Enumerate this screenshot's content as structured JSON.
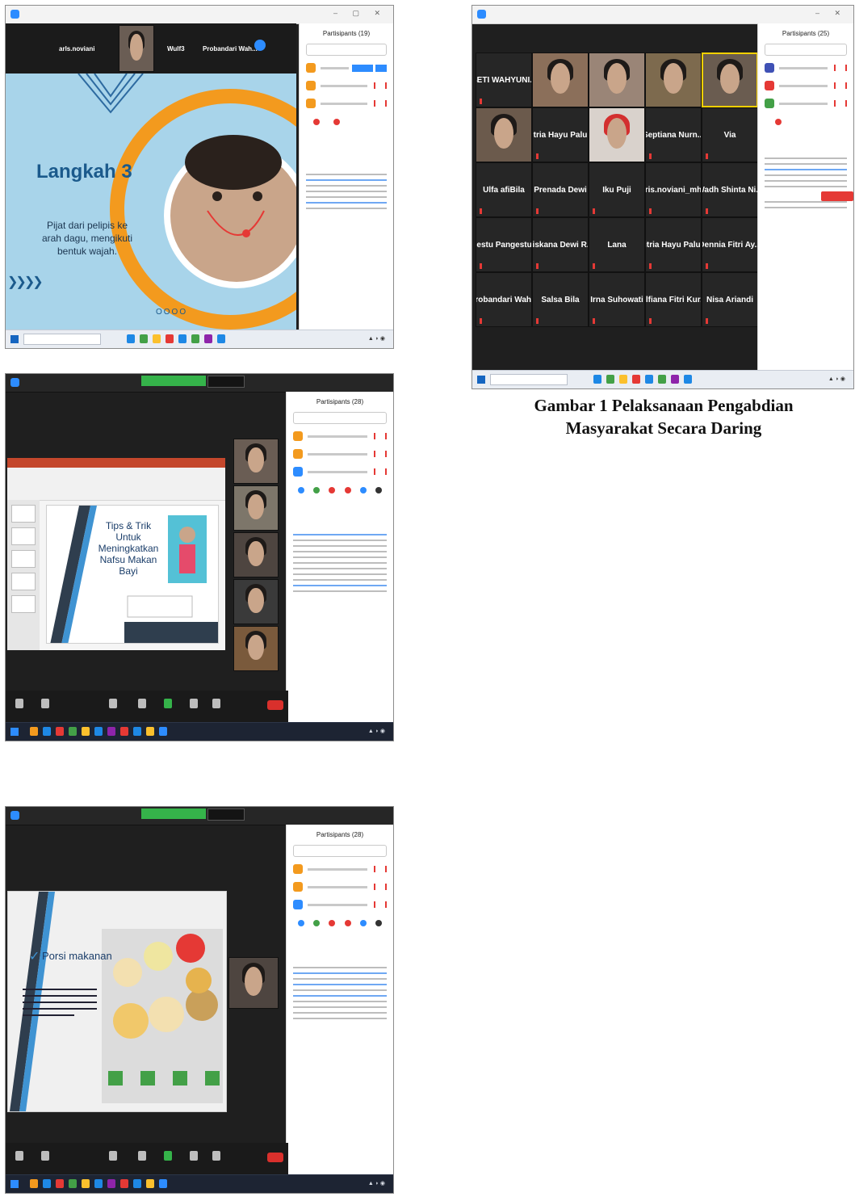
{
  "caption": {
    "line1": "Gambar 1 Pelaksanaan Pengabdian",
    "line2": "Masyarakat Secara Daring"
  },
  "shot1": {
    "top_names": [
      "arls.noviani",
      "Wulf3",
      "Probandari Wah..."
    ],
    "sidebar_header": "Partisipants (19)",
    "slide_title": "Langkah 3",
    "slide_text": "Pijat dari pelipis ke arah dagu, mengikuti bentuk wajah.",
    "dots": "OOOO"
  },
  "shot2": {
    "sidebar_header": "Partisipants (25)",
    "grid": [
      [
        "BETI WAHYUNI...",
        "",
        "",
        "",
        ""
      ],
      [
        "",
        "Fitria Hayu Palupi",
        "",
        "Septiana Nurn...",
        "Via"
      ],
      [
        "Ulfa afiBila",
        "Prenada Dewi",
        "Iku Puji",
        "aris.noviani_mhk",
        "Wadh Shinta Ni..."
      ],
      [
        "Restu Pangestuti",
        "Siskana Dewi R...",
        "Lana",
        "Fitria Hayu Palu...",
        "Dennia Fitri Ay..."
      ],
      [
        "Probandari Wah...",
        "Salsa Bila",
        "Irna Suhowati",
        "Alfiana Fitri Kur...",
        "Nisa Ariandi"
      ]
    ]
  },
  "shot3": {
    "slide_title": "Tips & Trik Untuk Meningkatkan Nafsu Makan Bayi",
    "sidebar_header": "Partisipants (28)"
  },
  "shot4": {
    "slide_title": "Porsi makanan",
    "sidebar_header": "Partisipants (28)"
  },
  "colors": {
    "zoom_blue": "#2d8cff",
    "slide_blue": "#a8d4ea",
    "accent_orange": "#f39a1e",
    "end_red": "#d9302c"
  }
}
